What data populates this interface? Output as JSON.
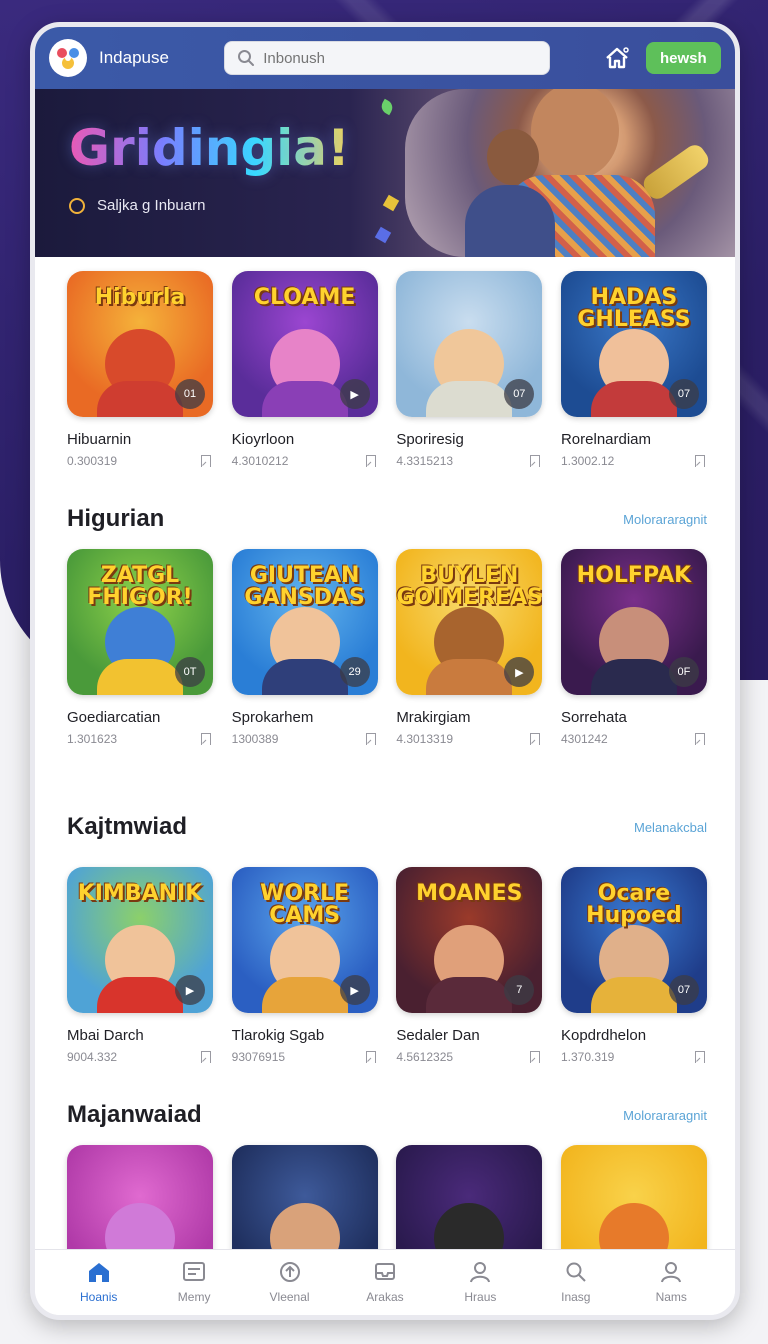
{
  "header": {
    "app_title": "Indapuse",
    "search_placeholder": "Inbonush",
    "news_button": "hewsh"
  },
  "banner": {
    "title": "Gridingia!",
    "subtitle": "Saljka g Inbuarn"
  },
  "rows": [
    {
      "section_title": "",
      "see_more": "",
      "cards": [
        {
          "thumb_text": "Hiburla",
          "badge": "01",
          "title": "Hibuarnin",
          "meta": "0.300319",
          "colors": [
            "#e96a24",
            "#f5b23a",
            "#d84a2b",
            "#cf3d30"
          ]
        },
        {
          "thumb_text": "CLOAME",
          "badge": "▶",
          "title": "Kioyrloon",
          "meta": "4.3010212",
          "colors": [
            "#5a2d9a",
            "#9b46d1",
            "#e783c8",
            "#8a3fb6"
          ]
        },
        {
          "thumb_text": "",
          "badge": "07",
          "title": "Sporiresig",
          "meta": "4.3315213",
          "colors": [
            "#8fb7d9",
            "#c9ddef",
            "#f0c79a",
            "#dcdcd0"
          ]
        },
        {
          "thumb_text": "HADAS GHLEASS",
          "badge": "07",
          "title": "Rorelnardiam",
          "meta": "1.3002.12",
          "colors": [
            "#1d4c93",
            "#3a78c8",
            "#f0c09a",
            "#c33b3b"
          ]
        }
      ]
    },
    {
      "section_title": "Higurian",
      "see_more": "Molorararagnit",
      "cards": [
        {
          "thumb_text": "ZATGL FHIGOR!",
          "badge": "0T",
          "title": "Goediarcatian",
          "meta": "1.301623",
          "colors": [
            "#4a9a3a",
            "#8ed24a",
            "#3f7fd6",
            "#f2c230"
          ]
        },
        {
          "thumb_text": "GIUTEAN GANSDAS",
          "badge": "29",
          "title": "Sprokarhem",
          "meta": "1300389",
          "colors": [
            "#2a7ed6",
            "#62b4ee",
            "#f0c39a",
            "#2f3f7a"
          ]
        },
        {
          "thumb_text": "BUYLEN GOIMEREAS!",
          "badge": "▶",
          "title": "Mrakirgiam",
          "meta": "4.3013319",
          "colors": [
            "#f2b51e",
            "#f7d96a",
            "#a8642e",
            "#c97b3e"
          ]
        },
        {
          "thumb_text": "HOLFPAK",
          "badge": "0F",
          "title": "Sorrehata",
          "meta": "4301242",
          "colors": [
            "#3a1a4e",
            "#7a2f8a",
            "#c88f7a",
            "#2a2a4e"
          ]
        }
      ]
    },
    {
      "section_title": "Kajtmwiad",
      "see_more": "Melanakcbal",
      "cards": [
        {
          "thumb_text": "KIMBANIK",
          "badge": "▶",
          "title": "Mbai Darch",
          "meta": "9004.332",
          "colors": [
            "#4fa3d6",
            "#8cd06a",
            "#f0c39a",
            "#d8342c"
          ]
        },
        {
          "thumb_text": "WORLE CAMS",
          "badge": "▶",
          "title": "Tlarokig Sgab",
          "meta": "93076915",
          "colors": [
            "#2b5fc2",
            "#5aa4ec",
            "#f0c39a",
            "#e7a43a"
          ]
        },
        {
          "thumb_text": "MOANES",
          "badge": "7",
          "title": "Sedaler Dan",
          "meta": "4.5612325",
          "colors": [
            "#4a2030",
            "#9a3a2a",
            "#e0a07a",
            "#5a2a3a"
          ]
        },
        {
          "thumb_text": "Ocare Hupoed",
          "badge": "07",
          "title": "Kopdrdhelon",
          "meta": "1.370.319",
          "colors": [
            "#1f3d8a",
            "#3a7ad2",
            "#e0b08a",
            "#e6b23a"
          ]
        }
      ]
    },
    {
      "section_title": "Majanwaiad",
      "see_more": "Molorararagnit",
      "cards": [
        {
          "thumb_text": "",
          "badge": "",
          "title": "",
          "meta": "",
          "colors": [
            "#b03aa8",
            "#e06ad0",
            "#d07ad8",
            "#f4d6ee"
          ]
        },
        {
          "thumb_text": "",
          "badge": "",
          "title": "",
          "meta": "",
          "colors": [
            "#1f2f5e",
            "#3e5a9a",
            "#d9a27a",
            "#3a2a1a"
          ]
        },
        {
          "thumb_text": "",
          "badge": "",
          "title": "",
          "meta": "",
          "colors": [
            "#2a1a4e",
            "#4a2a7a",
            "#2a2a2a",
            "#7a7a8a"
          ]
        },
        {
          "thumb_text": "",
          "badge": "",
          "title": "",
          "meta": "",
          "colors": [
            "#f2b51e",
            "#f9d24a",
            "#e77a2a",
            "#f3e2c4"
          ]
        }
      ]
    }
  ],
  "bottom_nav": [
    {
      "label": "Hoanis",
      "icon": "home-icon",
      "active": true
    },
    {
      "label": "Memy",
      "icon": "menu-icon",
      "active": false
    },
    {
      "label": "Vleenal",
      "icon": "upload-icon",
      "active": false
    },
    {
      "label": "Arakas",
      "icon": "inbox-icon",
      "active": false
    },
    {
      "label": "Hraus",
      "icon": "user-icon",
      "active": false
    },
    {
      "label": "Inasg",
      "icon": "search-icon",
      "active": false
    },
    {
      "label": "Nams",
      "icon": "profile-icon",
      "active": false
    }
  ],
  "colors": {
    "header": "#3b5aa8",
    "accent_green": "#5ec05a",
    "active_nav": "#2a6fd1",
    "link": "#5ba4d6",
    "background_purple": "#2b1f66"
  }
}
